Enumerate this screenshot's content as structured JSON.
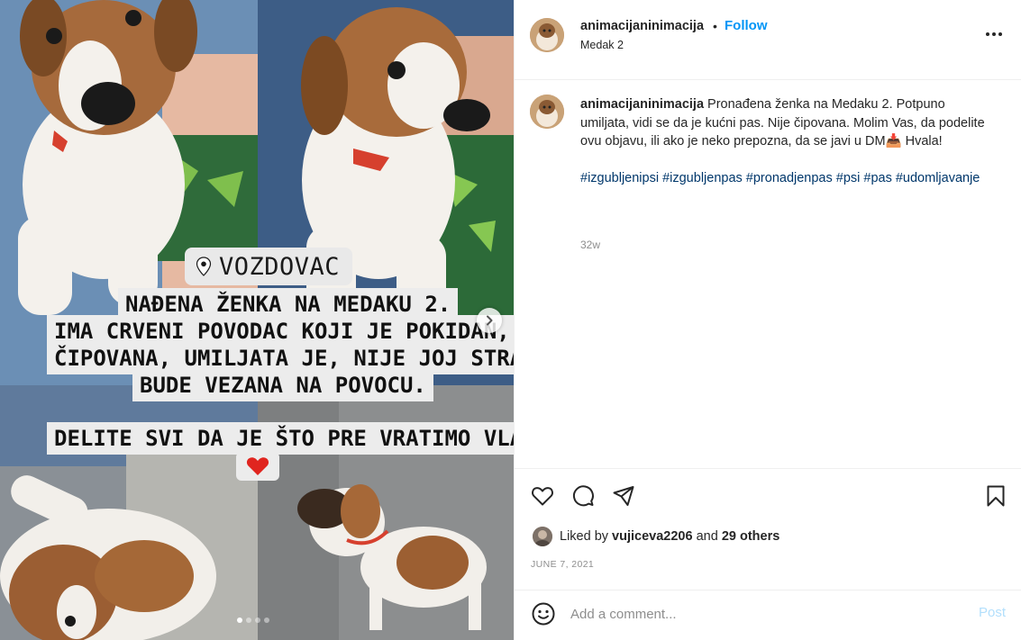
{
  "post": {
    "username": "animacijaninimacija",
    "separator": "•",
    "follow_label": "Follow",
    "location": "Medak 2",
    "more_icon": "more-horizontal-icon"
  },
  "caption": {
    "username": "animacijaninimacija",
    "text": "Pronađena ženka na Medaku 2. Potpuno umiljata, vidi se da je kućni pas. Nije čipovana. Molim Vas, da podelite ovu objavu, ili ako je neko prepozna, da se javi u DM📥 Hvala!",
    "hashtags": "#izgubljenipsi #izgubljenpas #pronadjenpas #psi #pas #udomljavanje",
    "age": "32w"
  },
  "media": {
    "location_sticker": "VOZDOVAC",
    "overlay_lines": [
      "NAĐENA ŽENKA NA MEDAKU 2.",
      "IMA CRVENI POVODAC  KOJI JE POKIDAN, NIJE",
      "ČIPOVANA, UMILJATA JE, NIJE JOJ STRANO DA",
      "BUDE VEZANA NA POVOCU."
    ],
    "overlay_footer": "DELITE SVI DA JE ŠTO PRE VRATIMO VLASNIKU",
    "heart": "❤️",
    "carousel_count": 4,
    "carousel_active": 0
  },
  "actions": {
    "like_icon": "heart-outline-icon",
    "comment_icon": "comment-bubble-icon",
    "share_icon": "paper-plane-icon",
    "save_icon": "bookmark-icon"
  },
  "likes": {
    "prefix": "Liked by",
    "user": "vujiceva2206",
    "conjunction": "and",
    "others": "29 others"
  },
  "date": "JUNE 7, 2021",
  "comment_box": {
    "placeholder": "Add a comment...",
    "post_label": "Post"
  },
  "colors": {
    "link_blue": "#0095f6",
    "hashtag_blue": "#00376b",
    "post_disabled": "#b2dffc",
    "secondary_text": "#8e8e8e"
  }
}
